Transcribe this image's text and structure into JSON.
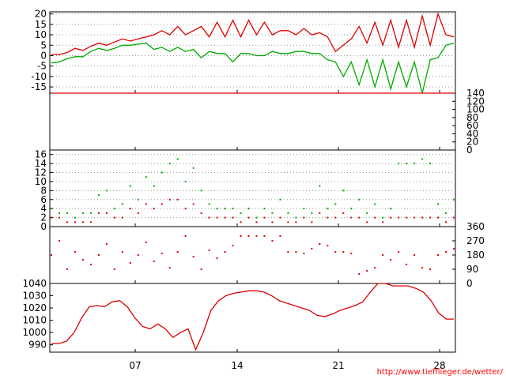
{
  "source_link": "http://www.tiefflieger.de/wetter/",
  "colors": {
    "red": "#dd0000",
    "green": "#00aa00",
    "grid": "#999999",
    "frame": "#000000",
    "link": "#ff0000"
  },
  "chart_data": [
    {
      "type": "line",
      "title": "",
      "x_ticks": [
        "07",
        "14",
        "21",
        "28"
      ],
      "y_ticks": [
        20,
        15,
        10,
        5,
        0,
        -5,
        -10,
        -15
      ],
      "ylim": [
        -18,
        21
      ],
      "grid": true,
      "series": [
        {
          "color": "red",
          "values": [
            0.5,
            0.5,
            1.5,
            3.5,
            2.5,
            4.5,
            6,
            5,
            6.5,
            8,
            7,
            8,
            9,
            10,
            12,
            10,
            14,
            10,
            12,
            14,
            9,
            16,
            9,
            17,
            9,
            17,
            10,
            16,
            10,
            12,
            12,
            10,
            13,
            10,
            11,
            9,
            2,
            5,
            8,
            14,
            6,
            16,
            5,
            17,
            4,
            17,
            4,
            19,
            5,
            20,
            10,
            9
          ]
        },
        {
          "color": "green",
          "values": [
            -3.5,
            -3,
            -1.5,
            -0.5,
            -0.5,
            2,
            3.5,
            2.5,
            3.5,
            5,
            5,
            5.5,
            6,
            3,
            4,
            2,
            4,
            2,
            3,
            -1,
            2,
            1,
            1,
            -3,
            1,
            1,
            0,
            0,
            2,
            1,
            1,
            2,
            2,
            1,
            1,
            -2,
            -3,
            -10,
            -3,
            -14,
            -2,
            -15,
            -2,
            -16,
            -3,
            -15,
            -3,
            -18,
            -2,
            -1,
            5,
            6
          ]
        }
      ]
    },
    {
      "type": "line",
      "title": "",
      "y_ticks": [
        140,
        120,
        100,
        80,
        60,
        40,
        20,
        0
      ],
      "ylim": [
        0,
        140
      ],
      "grid": false,
      "series": [
        {
          "color": "red",
          "values": [
            140,
            140,
            140,
            140,
            140,
            140,
            140,
            140,
            140,
            140,
            140,
            140,
            140,
            140,
            140,
            140,
            140,
            140,
            140,
            140,
            140,
            140,
            140,
            140,
            140,
            140,
            140,
            140,
            140,
            140,
            140,
            140,
            140,
            140,
            140,
            140,
            140,
            140,
            140,
            140,
            140,
            140,
            140,
            140,
            140,
            140,
            140,
            140,
            140,
            140,
            140,
            140
          ]
        }
      ]
    },
    {
      "type": "scatter",
      "title": "",
      "y_ticks": [
        16,
        14,
        12,
        10,
        8,
        6,
        4,
        2,
        0
      ],
      "ylim": [
        0,
        17
      ],
      "grid": true,
      "series": [
        {
          "color": "green",
          "values": [
            4,
            3,
            3,
            2,
            3,
            3,
            7,
            8,
            4,
            5,
            9,
            6,
            11,
            9,
            12,
            14,
            15,
            10,
            13,
            8,
            5,
            4,
            4,
            4,
            3,
            4,
            2,
            4,
            3,
            6,
            3,
            2,
            4,
            3,
            9,
            4,
            5,
            8,
            4,
            6,
            3,
            5,
            2,
            4,
            14,
            14,
            14,
            15,
            14,
            5,
            3,
            6
          ]
        },
        {
          "color": "red",
          "values": [
            2,
            2,
            1,
            1,
            1,
            1,
            3,
            3,
            2,
            2,
            4,
            3,
            5,
            4,
            5,
            6,
            6,
            4,
            5,
            3,
            2,
            2,
            2,
            2,
            1,
            2,
            1,
            2,
            1,
            2,
            1,
            1,
            2,
            1,
            3,
            2,
            2,
            3,
            2,
            2,
            1,
            2,
            1,
            2,
            2,
            2,
            2,
            2,
            2,
            2,
            1,
            2
          ]
        }
      ]
    },
    {
      "type": "scatter",
      "title": "",
      "y_ticks": [
        360,
        270,
        180,
        90,
        0
      ],
      "ylim": [
        0,
        360
      ],
      "grid": false,
      "series": [
        {
          "color": "red",
          "values": [
            180,
            270,
            90,
            200,
            150,
            120,
            180,
            250,
            90,
            200,
            130,
            180,
            260,
            140,
            190,
            100,
            200,
            300,
            170,
            90,
            210,
            160,
            200,
            240,
            300,
            300,
            300,
            300,
            270,
            300,
            200,
            200,
            190,
            220,
            250,
            240,
            200,
            200,
            190,
            60,
            80,
            100,
            180,
            150,
            200,
            120,
            180,
            100,
            90,
            180,
            200,
            220
          ]
        }
      ]
    },
    {
      "type": "line",
      "title": "",
      "x_ticks": [
        "07",
        "14",
        "21",
        "28"
      ],
      "y_ticks": [
        1040,
        1030,
        1020,
        1010,
        1000,
        990
      ],
      "ylim": [
        984,
        1040
      ],
      "grid": false,
      "series": [
        {
          "color": "red",
          "values": [
            991,
            991,
            993,
            1000,
            1012,
            1021,
            1022,
            1021,
            1025,
            1026,
            1021,
            1012,
            1005,
            1003,
            1007,
            1003,
            996,
            1000,
            1003,
            986,
            1000,
            1018,
            1026,
            1030,
            1032,
            1033,
            1034,
            1034,
            1033,
            1030,
            1026,
            1024,
            1022,
            1020,
            1018,
            1014,
            1013,
            1015,
            1018,
            1020,
            1022,
            1025,
            1033,
            1040,
            1040,
            1038,
            1038,
            1038,
            1036,
            1033,
            1026,
            1016,
            1011,
            1011
          ]
        }
      ]
    }
  ]
}
